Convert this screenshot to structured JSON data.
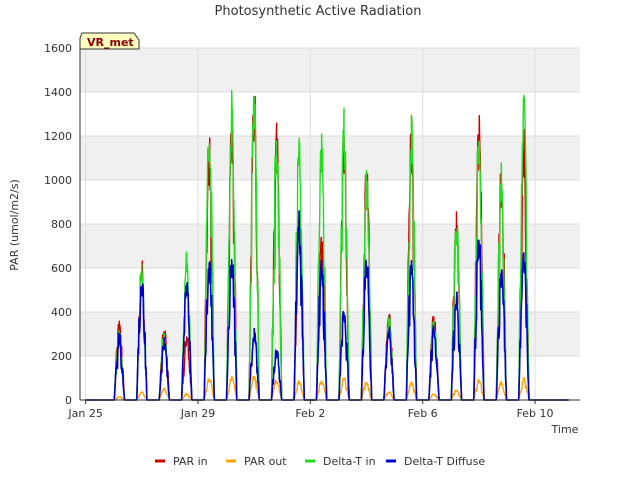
{
  "chart_data": {
    "type": "line",
    "title": "Photosynthetic Active Radiation",
    "xlabel": "Time",
    "ylabel": "PAR (umol/m2/s)",
    "badge": "VR_met",
    "ylim": [
      0,
      1600
    ],
    "xlim": [
      -0.5,
      44
    ],
    "y_ticks": [
      0,
      200,
      400,
      600,
      800,
      1000,
      1200,
      1400,
      1600
    ],
    "x_ticks": [
      {
        "day": 0,
        "label": "Jan 25"
      },
      {
        "day": 10,
        "label": "Jan 29"
      },
      {
        "day": 20,
        "label": "Feb 2"
      },
      {
        "day": 30,
        "label": "Feb 6"
      },
      {
        "day": 40,
        "label": "Feb 10"
      }
    ],
    "grid": true,
    "legend_position": "bottom",
    "days": [
      2,
      4,
      6,
      8,
      10,
      12,
      14,
      16,
      18,
      20,
      22,
      24,
      26,
      28,
      30,
      32,
      34,
      36,
      38,
      40,
      42
    ],
    "series": [
      {
        "name": "PAR in",
        "color": "#cc0000",
        "peaks": [
          360,
          670,
          340,
          300,
          1210,
          1350,
          1450,
          1270,
          860,
          750,
          1260,
          1080,
          400,
          1300,
          400,
          860,
          1310,
          1100,
          1250,
          0,
          0
        ]
      },
      {
        "name": "PAR out",
        "color": "#ffa500",
        "peaks": [
          15,
          40,
          55,
          30,
          105,
          110,
          115,
          95,
          90,
          90,
          110,
          85,
          40,
          85,
          30,
          50,
          95,
          85,
          105,
          0,
          0
        ]
      },
      {
        "name": "Delta-T in",
        "color": "#22dd22",
        "peaks": [
          320,
          640,
          310,
          700,
          1270,
          1410,
          1520,
          1270,
          1200,
          1240,
          1350,
          1070,
          390,
          1310,
          380,
          840,
          1290,
          1110,
          1440,
          0,
          0
        ]
      },
      {
        "name": "Delta-T Diffuse",
        "color": "#0000cc",
        "peaks": [
          310,
          590,
          290,
          570,
          650,
          680,
          330,
          240,
          860,
          660,
          420,
          680,
          350,
          640,
          360,
          500,
          780,
          620,
          720,
          0,
          0
        ]
      }
    ]
  }
}
